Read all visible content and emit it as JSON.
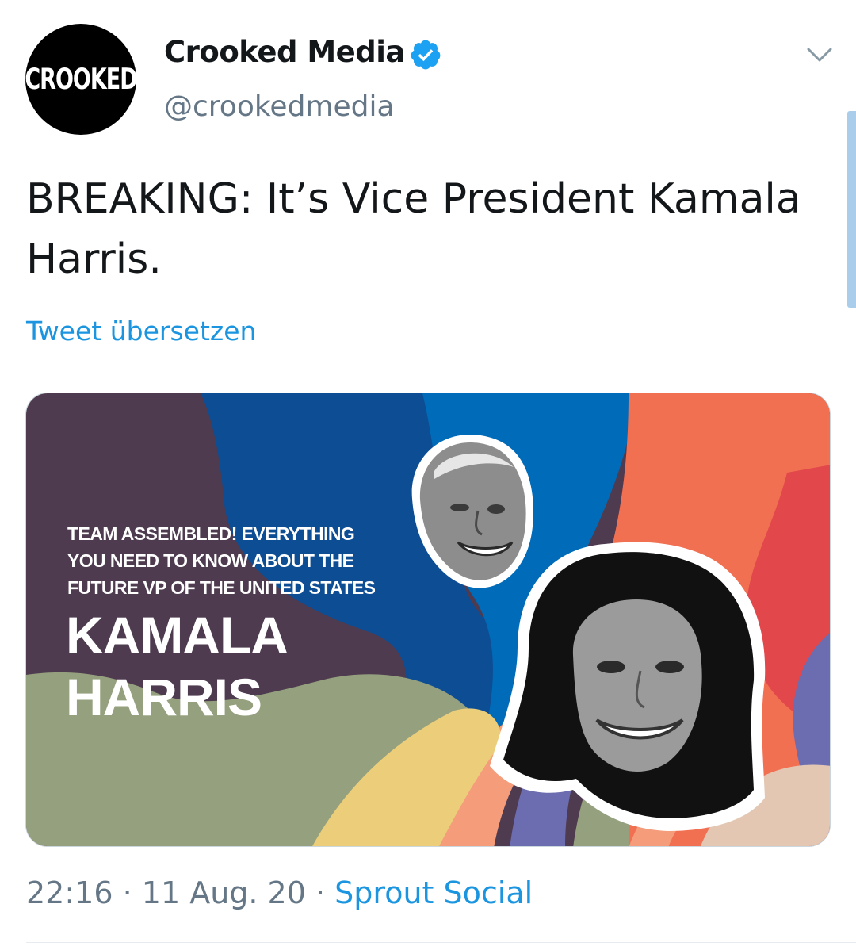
{
  "author": {
    "avatar_text": "CROOKED",
    "display_name": "Crooked Media",
    "handle": "@crookedmedia",
    "verified": true
  },
  "tweet": {
    "text": "BREAKING: It’s Vice President Kamala Harris.",
    "translate_label": "Tweet übersetzen"
  },
  "media": {
    "headline_lines": [
      "TEAM ASSEMBLED! EVERYTHING",
      "YOU NEED TO KNOW ABOUT THE",
      "FUTURE VP OF THE UNITED STATES"
    ],
    "name_lines": [
      "KAMALA",
      "HARRIS"
    ]
  },
  "meta": {
    "time": "22:16",
    "separator": " · ",
    "date": "11 Aug. 20",
    "source": "Sprout Social"
  },
  "colors": {
    "text_primary": "#14171a",
    "text_secondary": "#657786",
    "link": "#1b95e0",
    "verified": "#1da1f2"
  }
}
